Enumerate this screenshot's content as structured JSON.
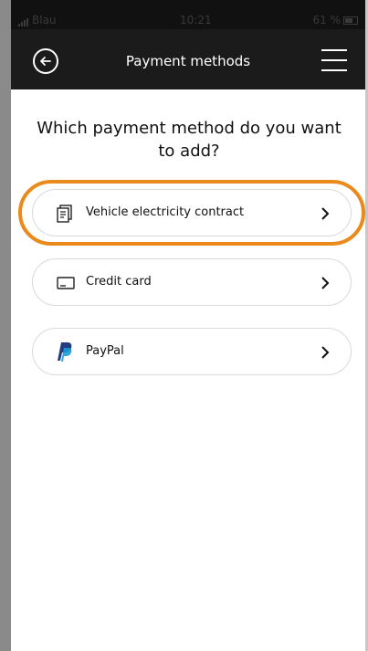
{
  "status_bar": {
    "carrier": "Blau",
    "time": "10:21",
    "battery": "61 %"
  },
  "header": {
    "title": "Payment methods",
    "back_icon": "back-arrow-circle-icon",
    "menu_icon": "hamburger-menu-icon"
  },
  "prompt": {
    "question": "Which payment method do you want to add?"
  },
  "options": [
    {
      "label": "Vehicle electricity contract",
      "icon": "contract-document-icon",
      "highlighted": true
    },
    {
      "label": "Credit card",
      "icon": "credit-card-icon",
      "highlighted": false
    },
    {
      "label": "PayPal",
      "icon": "paypal-logo-icon",
      "highlighted": false
    }
  ],
  "colors": {
    "header_bg": "#1b1b1b",
    "highlight": "#ea8a1c",
    "paypal_dark": "#253b80",
    "paypal_light": "#179bd7"
  }
}
